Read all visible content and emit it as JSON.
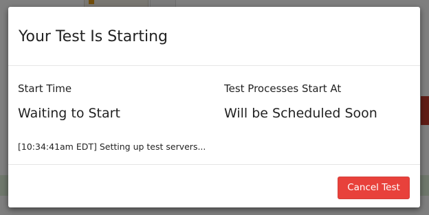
{
  "modal": {
    "title": "Your Test Is Starting",
    "start_time": {
      "label": "Start Time",
      "value": "Waiting to Start"
    },
    "processes_start": {
      "label": "Test Processes Start At",
      "value": "Will be Scheduled Soon"
    },
    "log_line": "[10:34:41am EDT] Setting up test servers...",
    "cancel_button_label": "Cancel Test"
  },
  "colors": {
    "cancel_button": "#e8413b",
    "overlay": "rgba(0,0,0,0.5)"
  }
}
